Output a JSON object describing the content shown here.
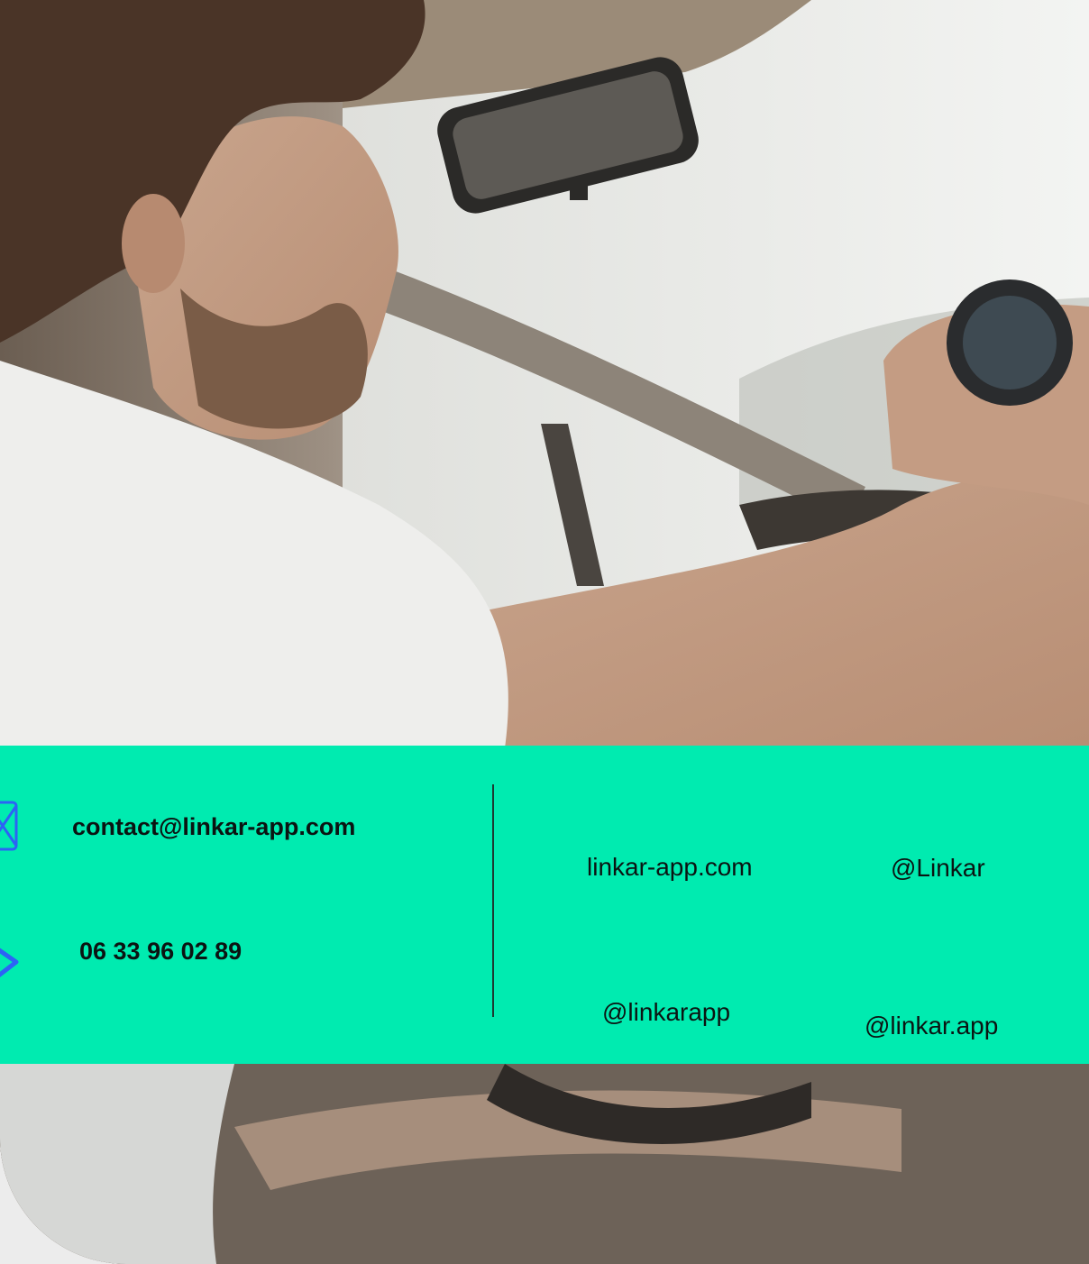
{
  "contact": {
    "email": "contact@linkar-app.com",
    "phone": "06 33 96 02 89",
    "email_icon": "mail-icon",
    "phone_icon": "phone-icon"
  },
  "links": {
    "website": "linkar-app.com",
    "handle_1": "@Linkar",
    "handle_2": "@linkarapp",
    "handle_3": "@linkar.app"
  },
  "colors": {
    "panel": "#00ebb0",
    "icon": "#2d63f5",
    "divider": "#1d3a32"
  }
}
